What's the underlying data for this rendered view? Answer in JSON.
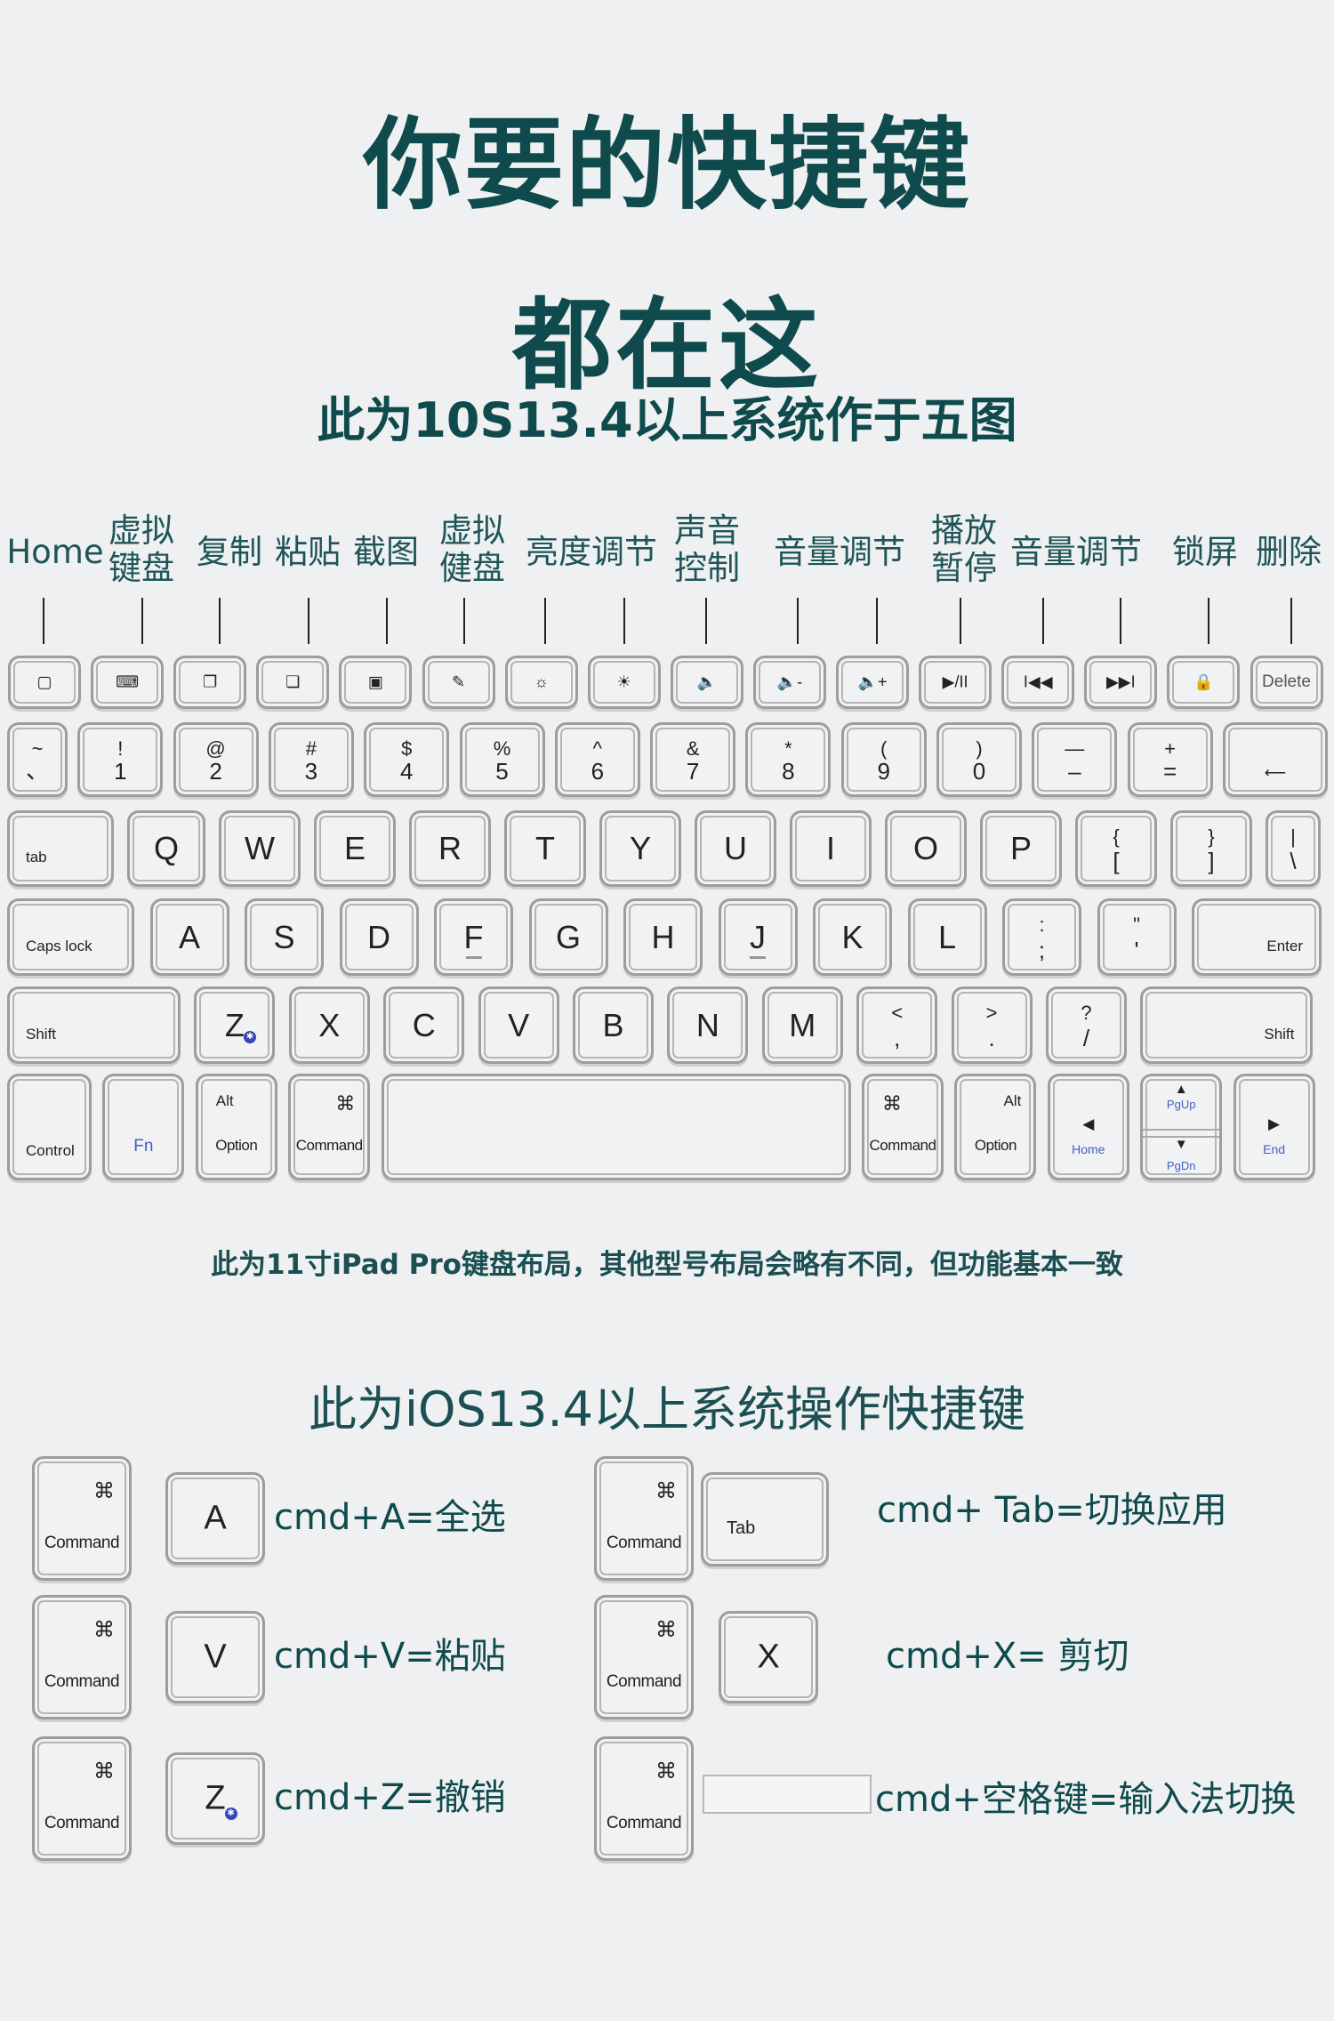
{
  "header": {
    "title_line1": "你要的快捷键",
    "title_line2": "都在这",
    "subtitle": "此为10S13.4以上系统作于五图"
  },
  "function_labels": [
    {
      "text": "Home",
      "lines": [
        "Home"
      ]
    },
    {
      "text": "虚拟键盘",
      "lines": [
        "虚拟",
        "键盘"
      ]
    },
    {
      "text": "复制",
      "lines": [
        "复制"
      ]
    },
    {
      "text": "粘贴",
      "lines": [
        "粘贴"
      ]
    },
    {
      "text": "截图",
      "lines": [
        "截图"
      ]
    },
    {
      "text": "虚拟健盘",
      "lines": [
        "虚拟",
        "健盘"
      ]
    },
    {
      "text": "亮度调节",
      "lines": [
        "亮度调节"
      ]
    },
    {
      "text": "声音控制",
      "lines": [
        "声音",
        "控制"
      ]
    },
    {
      "text": "音量调节",
      "lines": [
        "音量调节"
      ]
    },
    {
      "text": "播放暂停",
      "lines": [
        "播放",
        "暂停"
      ]
    },
    {
      "text": "音量调节",
      "lines": [
        "音量调节"
      ]
    },
    {
      "text": "锁屏",
      "lines": [
        "锁屏"
      ]
    },
    {
      "text": "删除",
      "lines": [
        "删除"
      ]
    }
  ],
  "keyboard": {
    "function_row": [
      {
        "name": "home",
        "icon": "home-square-icon",
        "glyph": "▢"
      },
      {
        "name": "virtual-keyboard",
        "icon": "keyboard-icon",
        "glyph": "⌨"
      },
      {
        "name": "copy",
        "icon": "copy-icon",
        "glyph": "❐"
      },
      {
        "name": "paste",
        "icon": "paste-icon",
        "glyph": "❏"
      },
      {
        "name": "screenshot",
        "icon": "screenshot-icon",
        "glyph": "▣"
      },
      {
        "name": "virtual-keyboard-2",
        "icon": "pen-icon",
        "glyph": "✎"
      },
      {
        "name": "brightness-down",
        "icon": "brightness-down-icon",
        "glyph": "☼"
      },
      {
        "name": "brightness-up",
        "icon": "brightness-up-icon",
        "glyph": "☀"
      },
      {
        "name": "mute",
        "icon": "speaker-mute-icon",
        "glyph": "🔈"
      },
      {
        "name": "volume-down",
        "icon": "volume-down-icon",
        "glyph": "🔈-"
      },
      {
        "name": "volume-up",
        "icon": "volume-up-icon",
        "glyph": "🔈+"
      },
      {
        "name": "play-pause",
        "icon": "play-pause-icon",
        "glyph": "▶/II"
      },
      {
        "name": "previous-track",
        "icon": "previous-track-icon",
        "glyph": "I◀◀"
      },
      {
        "name": "next-track",
        "icon": "next-track-icon",
        "glyph": "▶▶I"
      },
      {
        "name": "lock",
        "icon": "lock-icon",
        "glyph": "🔒"
      },
      {
        "name": "delete",
        "icon": "",
        "glyph": "",
        "label": "Delete"
      }
    ],
    "number_row": [
      {
        "top": "~",
        "bottom": "、"
      },
      {
        "top": "!",
        "bottom": "1"
      },
      {
        "top": "@",
        "bottom": "2"
      },
      {
        "top": "#",
        "bottom": "3"
      },
      {
        "top": "$",
        "bottom": "4"
      },
      {
        "top": "%",
        "bottom": "5"
      },
      {
        "top": "^",
        "bottom": "6"
      },
      {
        "top": "&",
        "bottom": "7"
      },
      {
        "top": "*",
        "bottom": "8"
      },
      {
        "top": "(",
        "bottom": "9"
      },
      {
        "top": ")",
        "bottom": "0"
      },
      {
        "top": "—",
        "bottom": "–"
      },
      {
        "top": "+",
        "bottom": "="
      },
      {
        "label": "Backspace",
        "arrow": "⟵"
      }
    ],
    "qwerty_row": [
      {
        "label": "tab"
      },
      {
        "main": "Q"
      },
      {
        "main": "W"
      },
      {
        "main": "E"
      },
      {
        "main": "R"
      },
      {
        "main": "T"
      },
      {
        "main": "Y"
      },
      {
        "main": "U"
      },
      {
        "main": "I"
      },
      {
        "main": "O"
      },
      {
        "main": "P"
      },
      {
        "top": "{",
        "bottom": "["
      },
      {
        "top": "}",
        "bottom": "]"
      },
      {
        "top": "|",
        "bottom": "\\"
      }
    ],
    "home_row": [
      {
        "label": "Caps lock"
      },
      {
        "main": "A"
      },
      {
        "main": "S"
      },
      {
        "main": "D"
      },
      {
        "main": "F",
        "bump": true
      },
      {
        "main": "G"
      },
      {
        "main": "H"
      },
      {
        "main": "J",
        "bump": true
      },
      {
        "main": "K"
      },
      {
        "main": "L"
      },
      {
        "top": ":",
        "bottom": ";"
      },
      {
        "top": "\"",
        "bottom": "'"
      },
      {
        "label": "Enter"
      }
    ],
    "shift_row": [
      {
        "label": "Shift"
      },
      {
        "main": "Z",
        "badge": "bluetooth"
      },
      {
        "main": "X"
      },
      {
        "main": "C"
      },
      {
        "main": "V"
      },
      {
        "main": "B"
      },
      {
        "main": "N"
      },
      {
        "main": "M"
      },
      {
        "top": "<",
        "bottom": ","
      },
      {
        "top": ">",
        "bottom": "."
      },
      {
        "top": "?",
        "bottom": "/"
      },
      {
        "label": "Shift",
        "align": "right"
      }
    ],
    "bottom_row": [
      {
        "label": "Control"
      },
      {
        "label": "Fn",
        "blue": true
      },
      {
        "top": "Alt",
        "bottom": "Option"
      },
      {
        "top": "⌘",
        "bottom": "Command",
        "topRight": true
      },
      {
        "label": "",
        "space": true
      },
      {
        "top": "⌘",
        "bottom": "Command"
      },
      {
        "top": "Alt",
        "bottom": "Option",
        "topRight": true
      },
      {
        "arrow": "◀",
        "sub": "Home"
      },
      {
        "arrowUp": "▲",
        "subUp": "PgUp",
        "arrowDown": "▼",
        "subDown": "PgDn"
      },
      {
        "arrow": "▶",
        "sub": "End"
      }
    ]
  },
  "note": "此为11寸iPad Pro键盘布局，其他型号布局会略有不同，但功能基本一致",
  "shortcuts_section": {
    "title": "此为iOS13.4以上系统操作快捷键",
    "command_key": {
      "symbol": "⌘",
      "label": "Command"
    },
    "items": [
      {
        "key": "A",
        "text": "cmd+A=全选"
      },
      {
        "key": "Tab",
        "text": "cmd+ Tab=切换应用"
      },
      {
        "key": "V",
        "text": "cmd+V=粘贴"
      },
      {
        "key": "X",
        "text": "cmd+X= 剪切"
      },
      {
        "key": "Z",
        "text": "cmd+Z=撤销",
        "badge": "bluetooth"
      },
      {
        "key": "",
        "text": "cmd+空格键=输入法切换",
        "space": true
      }
    ]
  },
  "colors": {
    "title": "#0f4a4c",
    "background": "#eff0f2",
    "fn_blue": "#3f5fc4",
    "bluetooth_badge": "#3446b8"
  }
}
